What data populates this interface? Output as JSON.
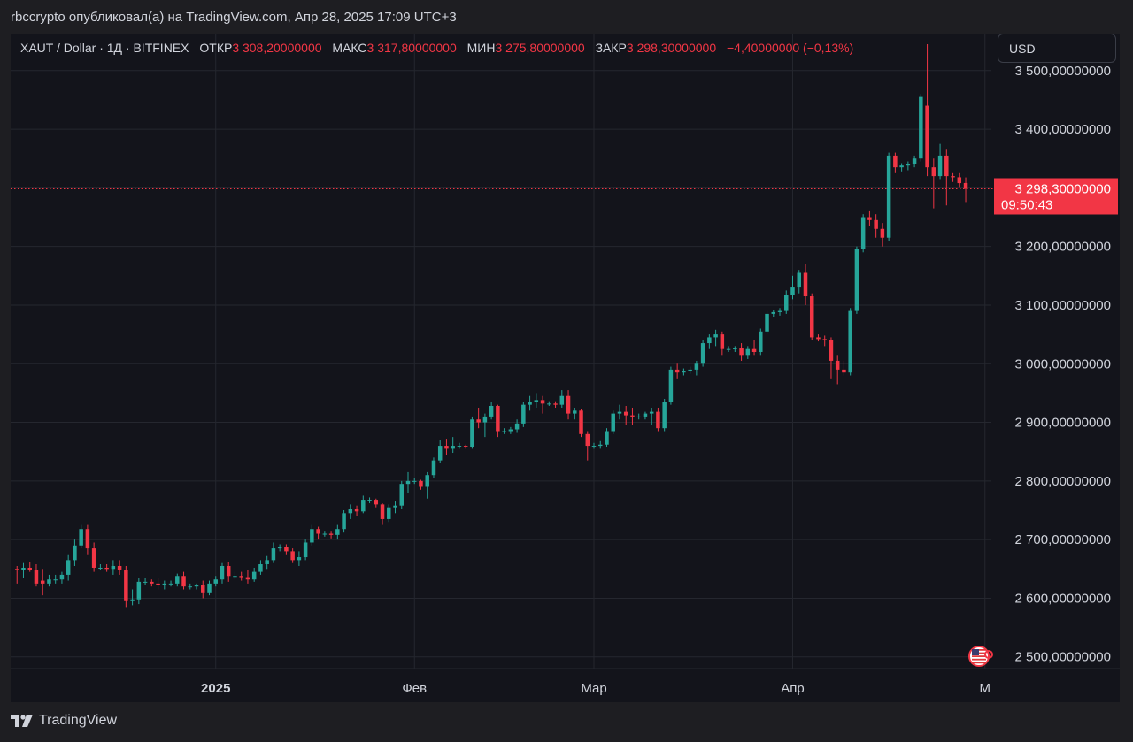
{
  "header": {
    "publish_line": "rbccrypto опубликовал(а) на TradingView.com, Апр 28, 2025 17:09 UTC+3"
  },
  "legend": {
    "symbol": "XAUT / Dollar · 1Д · BITFINEX",
    "open_label": "ОТКР",
    "open_value": "3 308,20000000",
    "high_label": "МАКС",
    "high_value": "3 317,80000000",
    "low_label": "МИН",
    "low_value": "3 275,80000000",
    "close_label": "ЗАКР",
    "close_value": "3 298,30000000",
    "change": "−4,40000000 (−0,13%)"
  },
  "currency_button": {
    "label": "USD"
  },
  "price_tag": {
    "price": "3 298,30000000",
    "countdown": "09:50:43"
  },
  "footer": {
    "brand": "TradingView"
  },
  "colors": {
    "up": "#26a69a",
    "down": "#f23645",
    "background": "#13141b",
    "grid": "#25272f",
    "text": "#d1d4dc"
  },
  "icons": {
    "flag": "us-flag-icon",
    "logo": "tradingview-logo-icon"
  },
  "chart_data": {
    "type": "candlestick",
    "title": "XAUT / Dollar · 1Д · BITFINEX",
    "currency": "USD",
    "ylim": [
      2480,
      3560
    ],
    "y_ticks": [
      2500,
      2600,
      2700,
      2800,
      2900,
      3000,
      3100,
      3200,
      3300,
      3400,
      3500
    ],
    "y_tick_labels": [
      "2 500,00000000",
      "2 600,00000000",
      "2 700,00000000",
      "2 800,00000000",
      "2 900,00000000",
      "3 000,00000000",
      "3 100,00000000",
      "3 200,00000000",
      "3 300,00000000",
      "3 400,00000000",
      "3 500,00000000"
    ],
    "x_ticks": [
      {
        "label": "2025",
        "date": "2025-01-01",
        "bold": true
      },
      {
        "label": "Фев",
        "date": "2025-02-01",
        "bold": false
      },
      {
        "label": "Мар",
        "date": "2025-03-01",
        "bold": false
      },
      {
        "label": "Апр",
        "date": "2025-04-01",
        "bold": false
      },
      {
        "label": "М",
        "date": "2025-05-01",
        "bold": false
      }
    ],
    "date_range": [
      "2024-11-30",
      "2025-05-02"
    ],
    "current_price": 3298.3,
    "grid": true,
    "candles": [
      {
        "d": "2024-12-01",
        "o": 2650,
        "h": 2655,
        "l": 2625,
        "c": 2648
      },
      {
        "d": "2024-12-02",
        "o": 2648,
        "h": 2660,
        "l": 2635,
        "c": 2652
      },
      {
        "d": "2024-12-03",
        "o": 2652,
        "h": 2662,
        "l": 2645,
        "c": 2648
      },
      {
        "d": "2024-12-04",
        "o": 2648,
        "h": 2658,
        "l": 2620,
        "c": 2625
      },
      {
        "d": "2024-12-05",
        "o": 2630,
        "h": 2650,
        "l": 2605,
        "c": 2625
      },
      {
        "d": "2024-12-06",
        "o": 2625,
        "h": 2640,
        "l": 2620,
        "c": 2632
      },
      {
        "d": "2024-12-07",
        "o": 2632,
        "h": 2640,
        "l": 2625,
        "c": 2632
      },
      {
        "d": "2024-12-08",
        "o": 2632,
        "h": 2645,
        "l": 2625,
        "c": 2640
      },
      {
        "d": "2024-12-09",
        "o": 2640,
        "h": 2675,
        "l": 2630,
        "c": 2665
      },
      {
        "d": "2024-12-10",
        "o": 2665,
        "h": 2700,
        "l": 2655,
        "c": 2690
      },
      {
        "d": "2024-12-11",
        "o": 2690,
        "h": 2725,
        "l": 2685,
        "c": 2718
      },
      {
        "d": "2024-12-12",
        "o": 2718,
        "h": 2725,
        "l": 2675,
        "c": 2685
      },
      {
        "d": "2024-12-13",
        "o": 2685,
        "h": 2695,
        "l": 2645,
        "c": 2652
      },
      {
        "d": "2024-12-14",
        "o": 2652,
        "h": 2658,
        "l": 2648,
        "c": 2652
      },
      {
        "d": "2024-12-15",
        "o": 2652,
        "h": 2658,
        "l": 2645,
        "c": 2650
      },
      {
        "d": "2024-12-16",
        "o": 2650,
        "h": 2665,
        "l": 2640,
        "c": 2655
      },
      {
        "d": "2024-12-17",
        "o": 2655,
        "h": 2665,
        "l": 2640,
        "c": 2648
      },
      {
        "d": "2024-12-18",
        "o": 2648,
        "h": 2655,
        "l": 2585,
        "c": 2595
      },
      {
        "d": "2024-12-19",
        "o": 2595,
        "h": 2615,
        "l": 2588,
        "c": 2598
      },
      {
        "d": "2024-12-20",
        "o": 2598,
        "h": 2635,
        "l": 2590,
        "c": 2628
      },
      {
        "d": "2024-12-21",
        "o": 2628,
        "h": 2635,
        "l": 2622,
        "c": 2628
      },
      {
        "d": "2024-12-22",
        "o": 2628,
        "h": 2632,
        "l": 2620,
        "c": 2625
      },
      {
        "d": "2024-12-23",
        "o": 2625,
        "h": 2635,
        "l": 2615,
        "c": 2622
      },
      {
        "d": "2024-12-24",
        "o": 2622,
        "h": 2630,
        "l": 2615,
        "c": 2625
      },
      {
        "d": "2024-12-25",
        "o": 2625,
        "h": 2630,
        "l": 2620,
        "c": 2625
      },
      {
        "d": "2024-12-26",
        "o": 2625,
        "h": 2642,
        "l": 2620,
        "c": 2638
      },
      {
        "d": "2024-12-27",
        "o": 2638,
        "h": 2645,
        "l": 2615,
        "c": 2620
      },
      {
        "d": "2024-12-28",
        "o": 2620,
        "h": 2625,
        "l": 2615,
        "c": 2620
      },
      {
        "d": "2024-12-29",
        "o": 2620,
        "h": 2625,
        "l": 2615,
        "c": 2622
      },
      {
        "d": "2024-12-30",
        "o": 2622,
        "h": 2630,
        "l": 2600,
        "c": 2610
      },
      {
        "d": "2024-12-31",
        "o": 2610,
        "h": 2630,
        "l": 2605,
        "c": 2625
      },
      {
        "d": "2025-01-01",
        "o": 2625,
        "h": 2638,
        "l": 2620,
        "c": 2632
      },
      {
        "d": "2025-01-02",
        "o": 2632,
        "h": 2660,
        "l": 2625,
        "c": 2655
      },
      {
        "d": "2025-01-03",
        "o": 2655,
        "h": 2662,
        "l": 2628,
        "c": 2638
      },
      {
        "d": "2025-01-04",
        "o": 2638,
        "h": 2645,
        "l": 2632,
        "c": 2638
      },
      {
        "d": "2025-01-05",
        "o": 2638,
        "h": 2645,
        "l": 2630,
        "c": 2636
      },
      {
        "d": "2025-01-06",
        "o": 2636,
        "h": 2648,
        "l": 2625,
        "c": 2632
      },
      {
        "d": "2025-01-07",
        "o": 2632,
        "h": 2652,
        "l": 2628,
        "c": 2645
      },
      {
        "d": "2025-01-08",
        "o": 2645,
        "h": 2665,
        "l": 2640,
        "c": 2658
      },
      {
        "d": "2025-01-09",
        "o": 2658,
        "h": 2672,
        "l": 2650,
        "c": 2665
      },
      {
        "d": "2025-01-10",
        "o": 2665,
        "h": 2695,
        "l": 2660,
        "c": 2685
      },
      {
        "d": "2025-01-11",
        "o": 2685,
        "h": 2692,
        "l": 2680,
        "c": 2688
      },
      {
        "d": "2025-01-12",
        "o": 2688,
        "h": 2692,
        "l": 2675,
        "c": 2680
      },
      {
        "d": "2025-01-13",
        "o": 2680,
        "h": 2685,
        "l": 2660,
        "c": 2665
      },
      {
        "d": "2025-01-14",
        "o": 2665,
        "h": 2680,
        "l": 2655,
        "c": 2670
      },
      {
        "d": "2025-01-15",
        "o": 2670,
        "h": 2700,
        "l": 2665,
        "c": 2695
      },
      {
        "d": "2025-01-16",
        "o": 2695,
        "h": 2725,
        "l": 2690,
        "c": 2718
      },
      {
        "d": "2025-01-17",
        "o": 2718,
        "h": 2722,
        "l": 2700,
        "c": 2710
      },
      {
        "d": "2025-01-18",
        "o": 2710,
        "h": 2715,
        "l": 2705,
        "c": 2710
      },
      {
        "d": "2025-01-19",
        "o": 2710,
        "h": 2715,
        "l": 2702,
        "c": 2708
      },
      {
        "d": "2025-01-20",
        "o": 2708,
        "h": 2725,
        "l": 2700,
        "c": 2718
      },
      {
        "d": "2025-01-21",
        "o": 2718,
        "h": 2750,
        "l": 2712,
        "c": 2745
      },
      {
        "d": "2025-01-22",
        "o": 2745,
        "h": 2760,
        "l": 2735,
        "c": 2752
      },
      {
        "d": "2025-01-23",
        "o": 2752,
        "h": 2758,
        "l": 2740,
        "c": 2748
      },
      {
        "d": "2025-01-24",
        "o": 2748,
        "h": 2775,
        "l": 2745,
        "c": 2768
      },
      {
        "d": "2025-01-25",
        "o": 2768,
        "h": 2772,
        "l": 2762,
        "c": 2768
      },
      {
        "d": "2025-01-26",
        "o": 2768,
        "h": 2770,
        "l": 2755,
        "c": 2760
      },
      {
        "d": "2025-01-27",
        "o": 2760,
        "h": 2762,
        "l": 2725,
        "c": 2735
      },
      {
        "d": "2025-01-28",
        "o": 2735,
        "h": 2760,
        "l": 2730,
        "c": 2755
      },
      {
        "d": "2025-01-29",
        "o": 2755,
        "h": 2765,
        "l": 2745,
        "c": 2758
      },
      {
        "d": "2025-01-30",
        "o": 2758,
        "h": 2800,
        "l": 2752,
        "c": 2795
      },
      {
        "d": "2025-01-31",
        "o": 2795,
        "h": 2815,
        "l": 2780,
        "c": 2800
      },
      {
        "d": "2025-02-01",
        "o": 2800,
        "h": 2805,
        "l": 2795,
        "c": 2800
      },
      {
        "d": "2025-02-02",
        "o": 2800,
        "h": 2802,
        "l": 2785,
        "c": 2790
      },
      {
        "d": "2025-02-03",
        "o": 2790,
        "h": 2815,
        "l": 2770,
        "c": 2810
      },
      {
        "d": "2025-02-04",
        "o": 2810,
        "h": 2840,
        "l": 2805,
        "c": 2835
      },
      {
        "d": "2025-02-05",
        "o": 2835,
        "h": 2870,
        "l": 2830,
        "c": 2860
      },
      {
        "d": "2025-02-06",
        "o": 2860,
        "h": 2872,
        "l": 2845,
        "c": 2855
      },
      {
        "d": "2025-02-07",
        "o": 2855,
        "h": 2875,
        "l": 2848,
        "c": 2860
      },
      {
        "d": "2025-02-08",
        "o": 2860,
        "h": 2865,
        "l": 2855,
        "c": 2860
      },
      {
        "d": "2025-02-09",
        "o": 2860,
        "h": 2862,
        "l": 2855,
        "c": 2858
      },
      {
        "d": "2025-02-10",
        "o": 2858,
        "h": 2910,
        "l": 2855,
        "c": 2905
      },
      {
        "d": "2025-02-11",
        "o": 2905,
        "h": 2925,
        "l": 2890,
        "c": 2900
      },
      {
        "d": "2025-02-12",
        "o": 2900,
        "h": 2915,
        "l": 2875,
        "c": 2910
      },
      {
        "d": "2025-02-13",
        "o": 2910,
        "h": 2935,
        "l": 2905,
        "c": 2928
      },
      {
        "d": "2025-02-14",
        "o": 2928,
        "h": 2930,
        "l": 2875,
        "c": 2885
      },
      {
        "d": "2025-02-15",
        "o": 2885,
        "h": 2890,
        "l": 2880,
        "c": 2885
      },
      {
        "d": "2025-02-16",
        "o": 2885,
        "h": 2892,
        "l": 2880,
        "c": 2888
      },
      {
        "d": "2025-02-17",
        "o": 2888,
        "h": 2905,
        "l": 2882,
        "c": 2898
      },
      {
        "d": "2025-02-18",
        "o": 2898,
        "h": 2935,
        "l": 2892,
        "c": 2930
      },
      {
        "d": "2025-02-19",
        "o": 2930,
        "h": 2945,
        "l": 2920,
        "c": 2935
      },
      {
        "d": "2025-02-20",
        "o": 2935,
        "h": 2950,
        "l": 2925,
        "c": 2938
      },
      {
        "d": "2025-02-21",
        "o": 2938,
        "h": 2945,
        "l": 2915,
        "c": 2932
      },
      {
        "d": "2025-02-22",
        "o": 2932,
        "h": 2936,
        "l": 2928,
        "c": 2932
      },
      {
        "d": "2025-02-23",
        "o": 2932,
        "h": 2936,
        "l": 2925,
        "c": 2930
      },
      {
        "d": "2025-02-24",
        "o": 2930,
        "h": 2955,
        "l": 2925,
        "c": 2945
      },
      {
        "d": "2025-02-25",
        "o": 2945,
        "h": 2955,
        "l": 2905,
        "c": 2915
      },
      {
        "d": "2025-02-26",
        "o": 2915,
        "h": 2925,
        "l": 2905,
        "c": 2920
      },
      {
        "d": "2025-02-27",
        "o": 2920,
        "h": 2922,
        "l": 2875,
        "c": 2880
      },
      {
        "d": "2025-02-28",
        "o": 2880,
        "h": 2885,
        "l": 2835,
        "c": 2860
      },
      {
        "d": "2025-03-01",
        "o": 2860,
        "h": 2865,
        "l": 2855,
        "c": 2860
      },
      {
        "d": "2025-03-02",
        "o": 2860,
        "h": 2868,
        "l": 2855,
        "c": 2862
      },
      {
        "d": "2025-03-03",
        "o": 2862,
        "h": 2890,
        "l": 2858,
        "c": 2885
      },
      {
        "d": "2025-03-04",
        "o": 2885,
        "h": 2920,
        "l": 2880,
        "c": 2915
      },
      {
        "d": "2025-03-05",
        "o": 2915,
        "h": 2930,
        "l": 2905,
        "c": 2918
      },
      {
        "d": "2025-03-06",
        "o": 2918,
        "h": 2928,
        "l": 2895,
        "c": 2912
      },
      {
        "d": "2025-03-07",
        "o": 2912,
        "h": 2925,
        "l": 2895,
        "c": 2910
      },
      {
        "d": "2025-03-08",
        "o": 2910,
        "h": 2915,
        "l": 2905,
        "c": 2910
      },
      {
        "d": "2025-03-09",
        "o": 2910,
        "h": 2918,
        "l": 2905,
        "c": 2915
      },
      {
        "d": "2025-03-10",
        "o": 2915,
        "h": 2925,
        "l": 2895,
        "c": 2918
      },
      {
        "d": "2025-03-11",
        "o": 2918,
        "h": 2925,
        "l": 2885,
        "c": 2890
      },
      {
        "d": "2025-03-12",
        "o": 2890,
        "h": 2940,
        "l": 2885,
        "c": 2935
      },
      {
        "d": "2025-03-13",
        "o": 2935,
        "h": 2995,
        "l": 2930,
        "c": 2990
      },
      {
        "d": "2025-03-14",
        "o": 2990,
        "h": 3000,
        "l": 2975,
        "c": 2985
      },
      {
        "d": "2025-03-15",
        "o": 2985,
        "h": 2992,
        "l": 2980,
        "c": 2988
      },
      {
        "d": "2025-03-16",
        "o": 2988,
        "h": 2995,
        "l": 2983,
        "c": 2990
      },
      {
        "d": "2025-03-17",
        "o": 2990,
        "h": 3005,
        "l": 2980,
        "c": 3000
      },
      {
        "d": "2025-03-18",
        "o": 3000,
        "h": 3040,
        "l": 2995,
        "c": 3035
      },
      {
        "d": "2025-03-19",
        "o": 3035,
        "h": 3050,
        "l": 3025,
        "c": 3045
      },
      {
        "d": "2025-03-20",
        "o": 3045,
        "h": 3058,
        "l": 3030,
        "c": 3050
      },
      {
        "d": "2025-03-21",
        "o": 3050,
        "h": 3055,
        "l": 3015,
        "c": 3025
      },
      {
        "d": "2025-03-22",
        "o": 3025,
        "h": 3030,
        "l": 3020,
        "c": 3025
      },
      {
        "d": "2025-03-23",
        "o": 3025,
        "h": 3030,
        "l": 3020,
        "c": 3026
      },
      {
        "d": "2025-03-24",
        "o": 3026,
        "h": 3035,
        "l": 3005,
        "c": 3015
      },
      {
        "d": "2025-03-25",
        "o": 3015,
        "h": 3030,
        "l": 3008,
        "c": 3025
      },
      {
        "d": "2025-03-26",
        "o": 3025,
        "h": 3040,
        "l": 3015,
        "c": 3020
      },
      {
        "d": "2025-03-27",
        "o": 3020,
        "h": 3060,
        "l": 3015,
        "c": 3055
      },
      {
        "d": "2025-03-28",
        "o": 3055,
        "h": 3090,
        "l": 3050,
        "c": 3085
      },
      {
        "d": "2025-03-29",
        "o": 3085,
        "h": 3092,
        "l": 3080,
        "c": 3088
      },
      {
        "d": "2025-03-30",
        "o": 3088,
        "h": 3095,
        "l": 3082,
        "c": 3090
      },
      {
        "d": "2025-03-31",
        "o": 3090,
        "h": 3125,
        "l": 3085,
        "c": 3118
      },
      {
        "d": "2025-04-01",
        "o": 3118,
        "h": 3150,
        "l": 3110,
        "c": 3130
      },
      {
        "d": "2025-04-02",
        "o": 3130,
        "h": 3160,
        "l": 3120,
        "c": 3155
      },
      {
        "d": "2025-04-03",
        "o": 3155,
        "h": 3170,
        "l": 3100,
        "c": 3115
      },
      {
        "d": "2025-04-04",
        "o": 3115,
        "h": 3120,
        "l": 3040,
        "c": 3045
      },
      {
        "d": "2025-04-05",
        "o": 3045,
        "h": 3050,
        "l": 3038,
        "c": 3042
      },
      {
        "d": "2025-04-06",
        "o": 3042,
        "h": 3048,
        "l": 3030,
        "c": 3040
      },
      {
        "d": "2025-04-07",
        "o": 3040,
        "h": 3045,
        "l": 2975,
        "c": 3005
      },
      {
        "d": "2025-04-08",
        "o": 3005,
        "h": 3015,
        "l": 2965,
        "c": 2990
      },
      {
        "d": "2025-04-09",
        "o": 2990,
        "h": 3005,
        "l": 2980,
        "c": 2985
      },
      {
        "d": "2025-04-10",
        "o": 2985,
        "h": 3095,
        "l": 2980,
        "c": 3090
      },
      {
        "d": "2025-04-11",
        "o": 3090,
        "h": 3200,
        "l": 3085,
        "c": 3195
      },
      {
        "d": "2025-04-12",
        "o": 3195,
        "h": 3255,
        "l": 3190,
        "c": 3250
      },
      {
        "d": "2025-04-13",
        "o": 3250,
        "h": 3260,
        "l": 3235,
        "c": 3245
      },
      {
        "d": "2025-04-14",
        "o": 3245,
        "h": 3255,
        "l": 3215,
        "c": 3230
      },
      {
        "d": "2025-04-15",
        "o": 3230,
        "h": 3240,
        "l": 3200,
        "c": 3215
      },
      {
        "d": "2025-04-16",
        "o": 3215,
        "h": 3360,
        "l": 3210,
        "c": 3355
      },
      {
        "d": "2025-04-17",
        "o": 3355,
        "h": 3360,
        "l": 3325,
        "c": 3335
      },
      {
        "d": "2025-04-18",
        "o": 3335,
        "h": 3342,
        "l": 3328,
        "c": 3338
      },
      {
        "d": "2025-04-19",
        "o": 3338,
        "h": 3345,
        "l": 3330,
        "c": 3340
      },
      {
        "d": "2025-04-20",
        "o": 3340,
        "h": 3355,
        "l": 3335,
        "c": 3350
      },
      {
        "d": "2025-04-21",
        "o": 3350,
        "h": 3460,
        "l": 3345,
        "c": 3455
      },
      {
        "d": "2025-04-22",
        "o": 3440,
        "h": 3545,
        "l": 3320,
        "c": 3335
      },
      {
        "d": "2025-04-23",
        "o": 3335,
        "h": 3350,
        "l": 3265,
        "c": 3320
      },
      {
        "d": "2025-04-24",
        "o": 3320,
        "h": 3375,
        "l": 3315,
        "c": 3355
      },
      {
        "d": "2025-04-25",
        "o": 3355,
        "h": 3365,
        "l": 3270,
        "c": 3320
      },
      {
        "d": "2025-04-26",
        "o": 3320,
        "h": 3325,
        "l": 3310,
        "c": 3318
      },
      {
        "d": "2025-04-27",
        "o": 3318,
        "h": 3325,
        "l": 3300,
        "c": 3308
      },
      {
        "d": "2025-04-28",
        "o": 3308.2,
        "h": 3317.8,
        "l": 3275.8,
        "c": 3298.3
      }
    ]
  }
}
